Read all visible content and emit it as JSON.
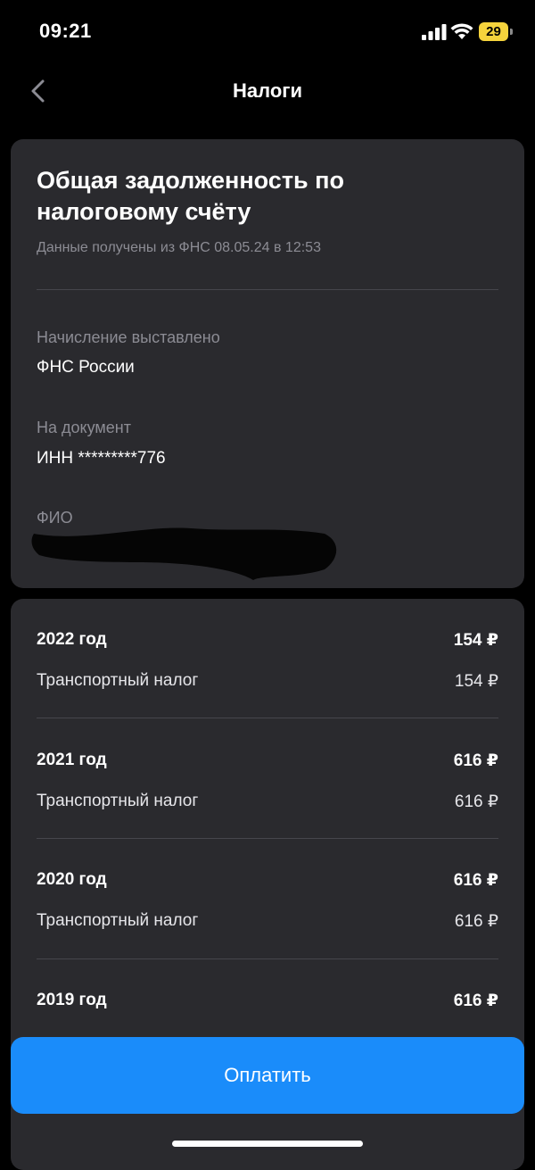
{
  "status_bar": {
    "time": "09:21",
    "battery": "29",
    "battery_color": "#f5d33c"
  },
  "header": {
    "title": "Налоги",
    "back_icon": "chevron-left-icon"
  },
  "summary": {
    "title": "Общая задолженность по налоговому счёту",
    "subtitle": "Данные получены из ФНС 08.05.24 в 12:53",
    "fields": [
      {
        "label": "Начисление выставлено",
        "value": "ФНС России"
      },
      {
        "label": "На документ",
        "value": "ИНН *********776"
      },
      {
        "label": "ФИО",
        "value": ""
      }
    ]
  },
  "years": [
    {
      "year": "2022 год",
      "total": "154 ₽",
      "items": [
        {
          "name": "Транспортный налог",
          "amount": "154 ₽"
        }
      ]
    },
    {
      "year": "2021 год",
      "total": "616 ₽",
      "items": [
        {
          "name": "Транспортный налог",
          "amount": "616 ₽"
        }
      ]
    },
    {
      "year": "2020 год",
      "total": "616 ₽",
      "items": [
        {
          "name": "Транспортный налог",
          "amount": "616 ₽"
        }
      ]
    },
    {
      "year": "2019 год",
      "total": "616 ₽",
      "items": []
    }
  ],
  "pay_button": {
    "label": "Оплатить",
    "color": "#1a8cfa"
  }
}
